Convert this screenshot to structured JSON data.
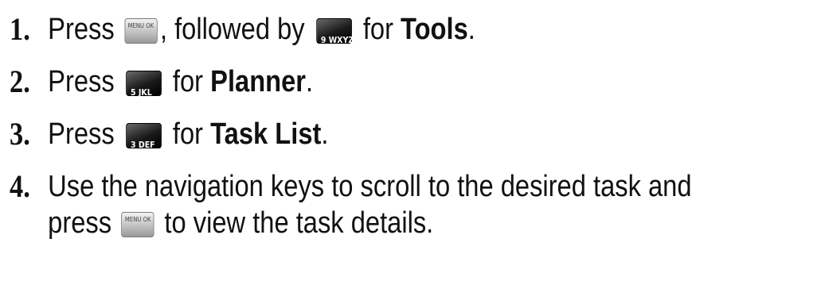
{
  "steps": [
    {
      "number": "1.",
      "parts": {
        "press": "Press",
        "followed": ", followed by",
        "for": "for",
        "target": "Tools",
        "end": "."
      },
      "keys": {
        "menu": "MENU OK",
        "nine": "9 WXYZ"
      }
    },
    {
      "number": "2.",
      "parts": {
        "press": "Press",
        "for": "for",
        "target": "Planner",
        "end": "."
      },
      "keys": {
        "five": "5 JKL"
      }
    },
    {
      "number": "3.",
      "parts": {
        "press": "Press",
        "for": "for",
        "target": "Task List",
        "end": "."
      },
      "keys": {
        "three": "3 DEF"
      }
    },
    {
      "number": "4.",
      "parts": {
        "line1": "Use the navigation keys to scroll to the desired task and",
        "press": "press",
        "rest": "to view the task details."
      },
      "keys": {
        "menu": "MENU OK"
      }
    }
  ],
  "icons": {
    "menu_key": "menu-ok-key-icon",
    "key_9": "key-9-icon",
    "key_5": "key-5-icon",
    "key_3": "key-3-icon"
  }
}
